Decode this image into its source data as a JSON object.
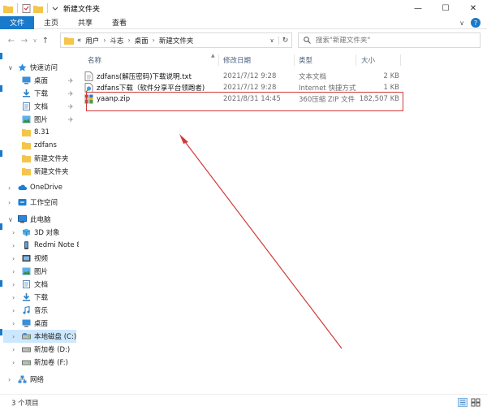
{
  "window": {
    "title": "新建文件夹",
    "minimize_glyph": "—",
    "maximize_glyph": "☐",
    "close_glyph": "✕"
  },
  "ribbon": {
    "tabs": [
      "文件",
      "主页",
      "共享",
      "查看"
    ],
    "collapse_glyph": "∨",
    "help_glyph": "?"
  },
  "nav": {
    "back_glyph": "←",
    "forward_glyph": "→",
    "recent_glyph": "∨",
    "up_glyph": "↑",
    "breadcrumb_prefix": "«",
    "breadcrumb": [
      "用户",
      "斗志",
      "桌面",
      "新建文件夹"
    ],
    "breadcrumb_sep": "›",
    "dropdown_glyph": "∨",
    "refresh_glyph": "↻"
  },
  "search": {
    "placeholder": "搜索\"新建文件夹\""
  },
  "sidebar": {
    "expand_glyph": "›",
    "collapse_glyph": "∨",
    "pin_glyph": "✈",
    "items": [
      {
        "label": "快速访问",
        "icon": "star-icon"
      },
      {
        "label": "桌面",
        "icon": "desktop-icon",
        "pinned": true
      },
      {
        "label": "下载",
        "icon": "download-icon",
        "pinned": true
      },
      {
        "label": "文档",
        "icon": "document-icon",
        "pinned": true
      },
      {
        "label": "图片",
        "icon": "pictures-icon",
        "pinned": true
      },
      {
        "label": "8.31",
        "icon": "folder-icon"
      },
      {
        "label": "zdfans",
        "icon": "folder-icon"
      },
      {
        "label": "新建文件夹",
        "icon": "folder-icon"
      },
      {
        "label": "新建文件夹",
        "icon": "folder-icon"
      },
      {
        "label": "OneDrive",
        "icon": "cloud-icon"
      },
      {
        "label": "工作空间",
        "icon": "workspace-icon"
      },
      {
        "label": "此电脑",
        "icon": "computer-icon"
      },
      {
        "label": "3D 对象",
        "icon": "3d-objects-icon"
      },
      {
        "label": "Redmi Note 8",
        "icon": "phone-icon"
      },
      {
        "label": "视频",
        "icon": "video-icon"
      },
      {
        "label": "图片",
        "icon": "pictures-icon"
      },
      {
        "label": "文档",
        "icon": "document-icon"
      },
      {
        "label": "下载",
        "icon": "download-icon"
      },
      {
        "label": "音乐",
        "icon": "music-icon"
      },
      {
        "label": "桌面",
        "icon": "desktop-icon"
      },
      {
        "label": "本地磁盘 (C:)",
        "icon": "drive-c-icon"
      },
      {
        "label": "新加卷 (D:)",
        "icon": "drive-icon"
      },
      {
        "label": "新加卷 (F:)",
        "icon": "drive-icon"
      },
      {
        "label": "网络",
        "icon": "network-icon"
      }
    ]
  },
  "columns": {
    "name": "名称",
    "date": "修改日期",
    "type": "类型",
    "size": "大小"
  },
  "files": [
    {
      "name": "zdfans(解压密码)下载说明.txt",
      "date": "2021/7/12 9:28",
      "type": "文本文档",
      "size": "2 KB",
      "icon": "text-file-icon"
    },
    {
      "name": "zdfans下载（软件分享平台领跑者)",
      "date": "2021/7/12 9:28",
      "type": "Internet 快捷方式",
      "size": "1 KB",
      "icon": "internet-shortcut-icon"
    },
    {
      "name": "yaanp.zip",
      "date": "2021/8/31 14:45",
      "type": "360压缩 ZIP 文件",
      "size": "182,507 KB",
      "icon": "zip-file-icon"
    }
  ],
  "status": {
    "item_count": "3 个项目"
  },
  "colors": {
    "accent": "#1979ca",
    "annotation_red": "#d23a3a",
    "folder_yellow": "#f4c54a"
  }
}
